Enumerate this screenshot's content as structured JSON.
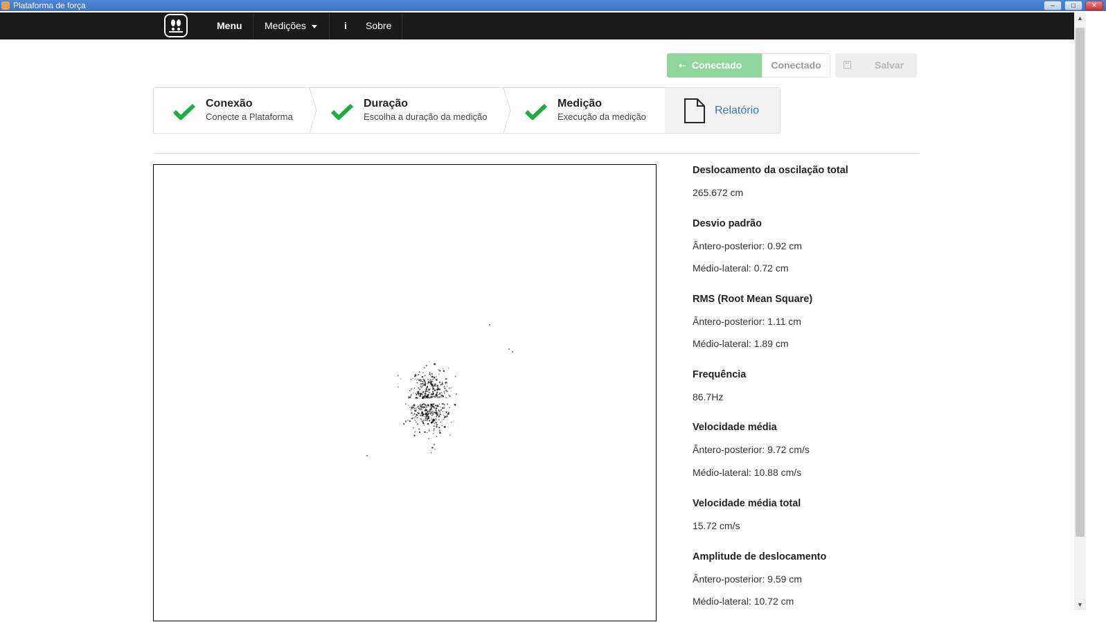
{
  "window": {
    "title": "Plataforma de força"
  },
  "navbar": {
    "brand": "Menu",
    "measurements": "Medições",
    "info_glyph": "i",
    "about": "Sobre"
  },
  "actions": {
    "connected_button": "Conectado",
    "connection_status": "Conectado",
    "save_button": "Salvar"
  },
  "steps": [
    {
      "title": "Conexão",
      "desc": "Conecte a Plataforma",
      "state": "done"
    },
    {
      "title": "Duração",
      "desc": "Escolha a duração da medição",
      "state": "done"
    },
    {
      "title": "Medição",
      "desc": "Execução da medição",
      "state": "done"
    },
    {
      "title": "Relatório",
      "state": "active"
    }
  ],
  "stats": {
    "total_displacement": {
      "label": "Deslocamento da oscilação total",
      "value": "265.672 cm"
    },
    "std_dev": {
      "label": "Desvio padrão",
      "ap": "Ântero-posterior: 0.92 cm",
      "ml": "Médio-lateral: 0.72 cm"
    },
    "rms": {
      "label": "RMS (Root Mean Square)",
      "ap": "Ântero-posterior: 1.11 cm",
      "ml": "Médio-lateral: 1.89 cm"
    },
    "frequency": {
      "label": "Frequência",
      "value": "86.7Hz"
    },
    "mean_velocity": {
      "label": "Velocidade média",
      "ap": "Ântero-posterior: 9.72 cm/s",
      "ml": "Médio-lateral: 10.88 cm/s"
    },
    "total_mean_velocity": {
      "label": "Velocidade média total",
      "value": "15.72 cm/s"
    },
    "amplitude": {
      "label": "Amplitude de deslocamento",
      "ap": "Ântero-posterior: 9.59 cm",
      "ml": "Médio-lateral: 10.72 cm"
    }
  },
  "colors": {
    "check": "#22aa44",
    "active_link": "#337ab7",
    "connected_bg": "#8fd69a"
  },
  "icons": [
    "footprints-logo-icon",
    "caret-down-icon",
    "info-icon",
    "usb-icon",
    "floppy-disk-icon",
    "checkmark-icon",
    "document-icon"
  ]
}
